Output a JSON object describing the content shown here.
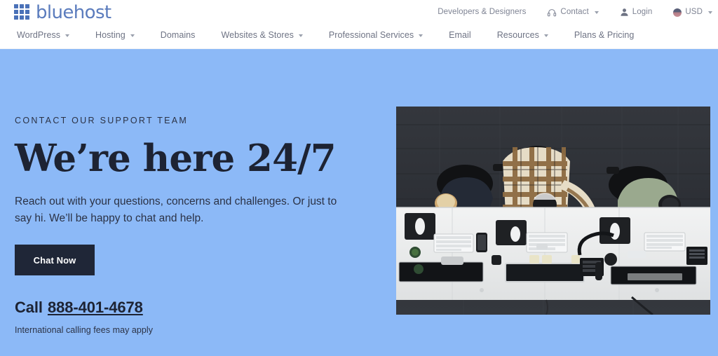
{
  "header": {
    "logo": {
      "name": "bluehost",
      "icon": "grid-squares-icon",
      "color": "#5b7cbd"
    },
    "utility_nav": [
      {
        "label": "Developers & Designers",
        "icon": null,
        "caret": false
      },
      {
        "label": "Contact",
        "icon": "headset-icon",
        "caret": true
      },
      {
        "label": "Login",
        "icon": "user-icon",
        "caret": false
      },
      {
        "label": "USD",
        "icon": "us-flag-icon",
        "caret": true
      }
    ],
    "main_nav": [
      {
        "label": "WordPress",
        "caret": true
      },
      {
        "label": "Hosting",
        "caret": true
      },
      {
        "label": "Domains",
        "caret": false
      },
      {
        "label": "Websites & Stores",
        "caret": true
      },
      {
        "label": "Professional Services",
        "caret": true
      },
      {
        "label": "Email",
        "caret": false
      },
      {
        "label": "Resources",
        "caret": true
      },
      {
        "label": "Plans & Pricing",
        "caret": false
      }
    ]
  },
  "hero": {
    "eyebrow": "Contact our support team",
    "headline": "We’re here 24/7",
    "subcopy": "Reach out with your questions, concerns and challenges. Or just to say hi. We’ll be happy to chat and help.",
    "chat_button": "Chat Now",
    "call_prefix": "Call",
    "phone_number": "888-401-4678",
    "fineprint": "International calling fees may apply",
    "background_color": "#8cb9f7",
    "image_alt": "Top-down view of three people working at a long white desk with keyboards, monitors and a desk phone on a dark wood floor"
  }
}
